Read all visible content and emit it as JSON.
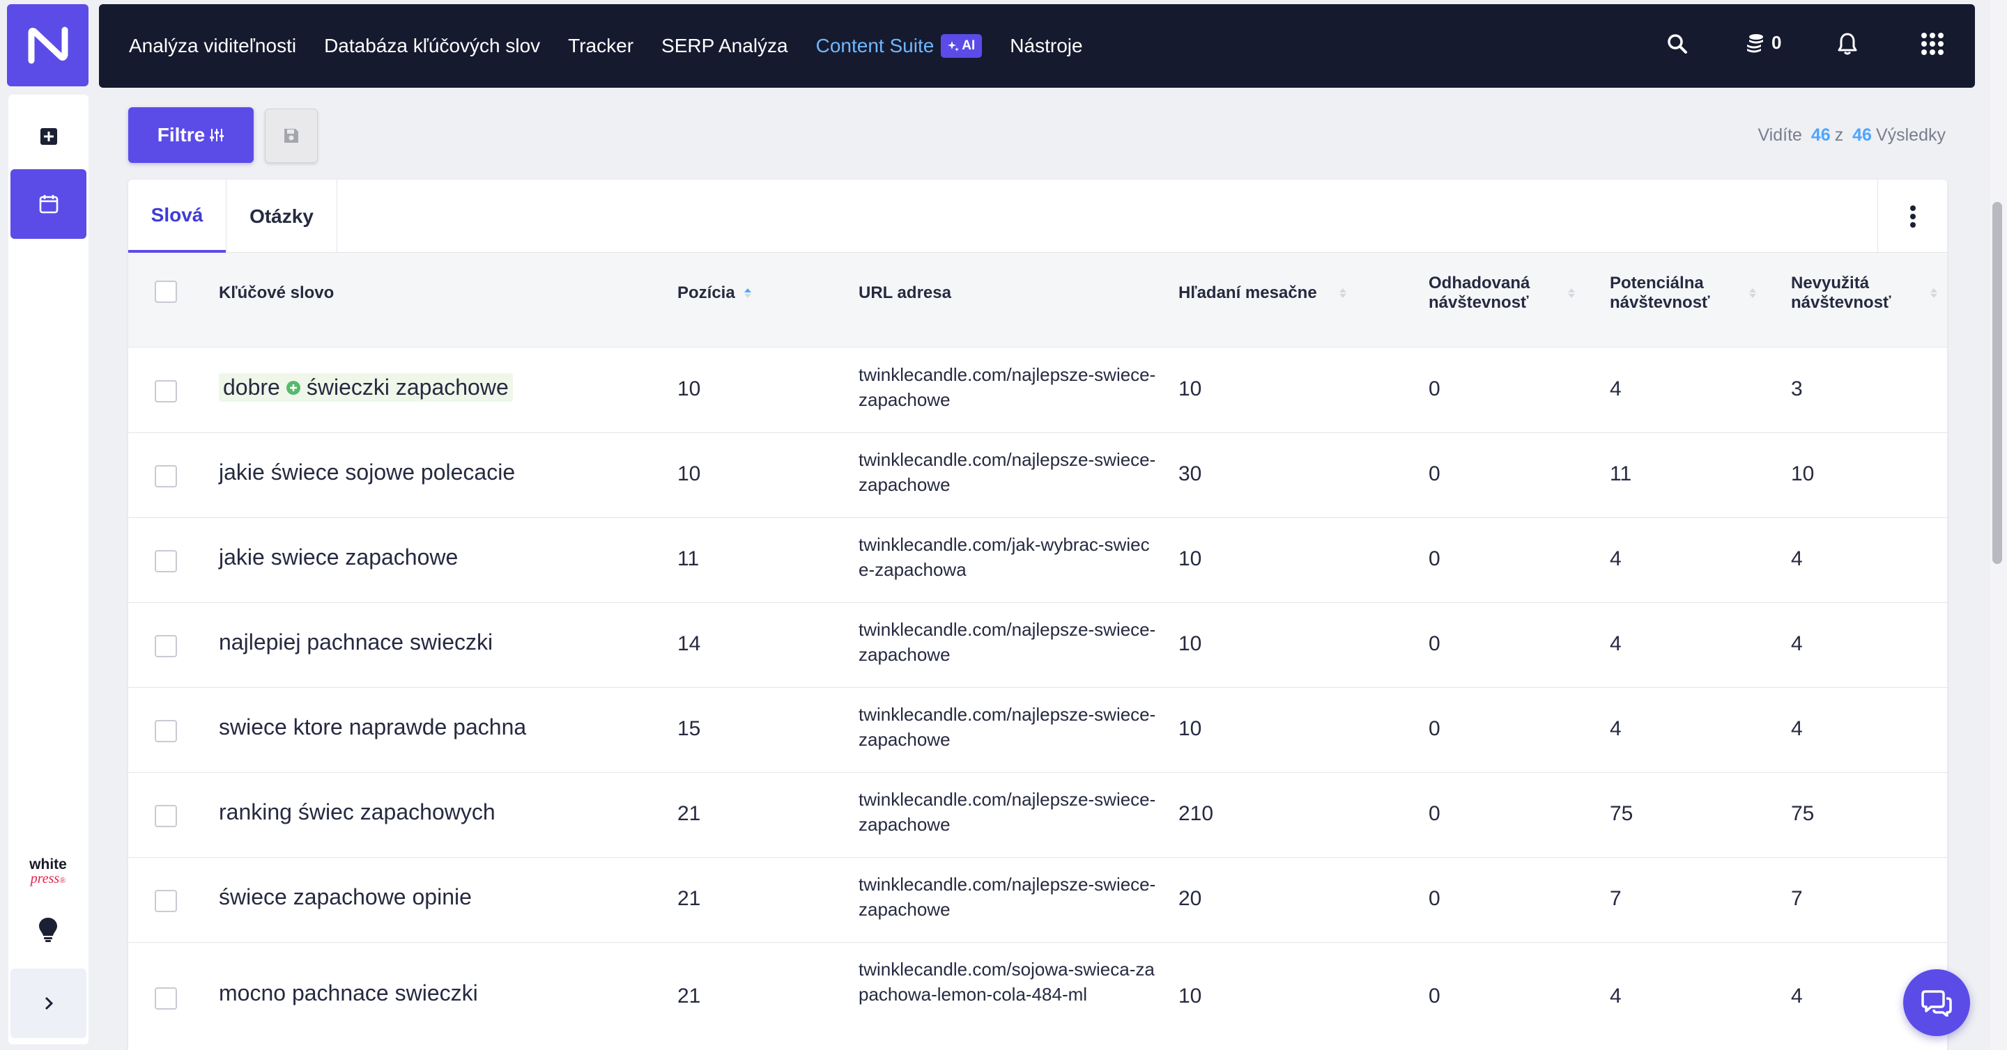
{
  "nav": {
    "items": [
      {
        "label": "Analýza viditeľnosti"
      },
      {
        "label": "Databáza kľúčových slov"
      },
      {
        "label": "Tracker"
      },
      {
        "label": "SERP Analýza"
      },
      {
        "label": "Content Suite",
        "badge": "AI"
      },
      {
        "label": "Nástroje"
      }
    ],
    "credits": "0"
  },
  "sidebar": {
    "brand_line1": "white",
    "brand_line2": "press",
    "brand_mark": "®"
  },
  "toolbar": {
    "filter_label": "Filtre",
    "results_prefix": "Vidíte",
    "results_shown": "46",
    "results_sep": "z",
    "results_total": "46",
    "results_suffix": "Výsledky"
  },
  "tabs": [
    {
      "label": "Slová",
      "active": true
    },
    {
      "label": "Otázky",
      "active": false
    }
  ],
  "table": {
    "headers": {
      "keyword": "Kľúčové slovo",
      "position": "Pozícia",
      "url": "URL adresa",
      "monthly": "Hľadaní mesačne",
      "est_line1": "Odhadovaná",
      "est_line2": "návštevnosť",
      "pot_line1": "Potenciálna",
      "pot_line2": "návštevnosť",
      "unused_line1": "Nevyužitá",
      "unused_line2": "návštevnosť"
    },
    "rows": [
      {
        "kw_a": "dobre",
        "kw_b": "świeczki zapachowe",
        "position": "10",
        "url": "twinklecandle.com/najlepsze-swiece-zapachowe",
        "monthly": "10",
        "est": "0",
        "pot": "4",
        "unused": "3"
      },
      {
        "kw": "jakie świece sojowe polecacie",
        "position": "10",
        "url": "twinklecandle.com/najlepsze-swiece-zapachowe",
        "monthly": "30",
        "est": "0",
        "pot": "11",
        "unused": "10"
      },
      {
        "kw": "jakie swiece zapachowe",
        "position": "11",
        "url": "twinklecandle.com/jak-wybrac-swiece-zapachowa",
        "monthly": "10",
        "est": "0",
        "pot": "4",
        "unused": "4"
      },
      {
        "kw": "najlepiej pachnace swieczki",
        "position": "14",
        "url": "twinklecandle.com/najlepsze-swiece-zapachowe",
        "monthly": "10",
        "est": "0",
        "pot": "4",
        "unused": "4"
      },
      {
        "kw": "swiece ktore naprawde pachna",
        "position": "15",
        "url": "twinklecandle.com/najlepsze-swiece-zapachowe",
        "monthly": "10",
        "est": "0",
        "pot": "4",
        "unused": "4"
      },
      {
        "kw": "ranking świec zapachowych",
        "position": "21",
        "url": "twinklecandle.com/najlepsze-swiece-zapachowe",
        "monthly": "210",
        "est": "0",
        "pot": "75",
        "unused": "75"
      },
      {
        "kw": "świece zapachowe opinie",
        "position": "21",
        "url": "twinklecandle.com/najlepsze-swiece-zapachowe",
        "monthly": "20",
        "est": "0",
        "pot": "7",
        "unused": "7"
      },
      {
        "kw": "mocno pachnace swieczki",
        "position": "21",
        "url": "twinklecandle.com/sojowa-swieca-zapachowa-lemon-cola-484-ml",
        "monthly": "10",
        "est": "0",
        "pot": "4",
        "unused": "4"
      }
    ]
  },
  "colors": {
    "accent": "#5b4ce8",
    "nav_bg": "#161a2f",
    "active_link": "#6fb8ff",
    "results_num": "#4ea5ff"
  }
}
